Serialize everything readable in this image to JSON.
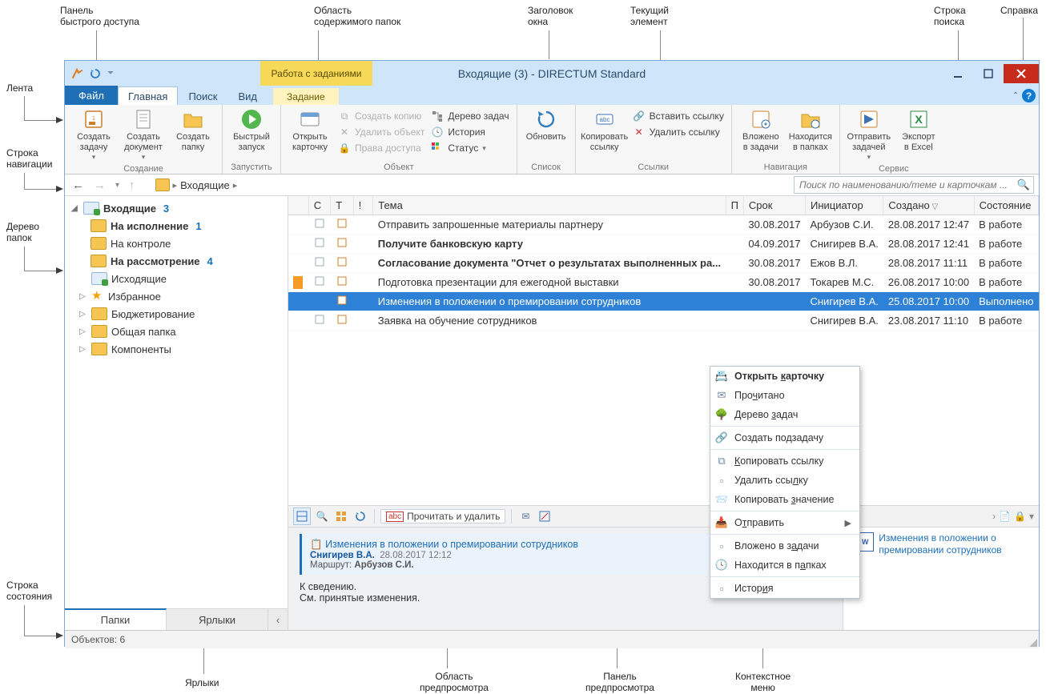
{
  "callouts": {
    "qat": "Панель\nбыстрого доступа",
    "folder_content": "Область\nсодержимого папок",
    "window_title": "Заголовок\nокна",
    "current_element": "Текущий\nэлемент",
    "search_bar": "Строка\nпоиска",
    "help": "Справка",
    "ribbon": "Лента",
    "nav_bar": "Строка\nнавигации",
    "folder_tree": "Дерево\nпапок",
    "status_bar": "Строка\nсостояния",
    "shortcuts": "Ярлыки",
    "preview_area": "Область\nпредпросмотра",
    "preview_panel": "Панель\nпредпросмотра",
    "context_menu": "Контекстное\nменю"
  },
  "titlebar": {
    "title": "Входящие (3) - DIRECTUM Standard"
  },
  "contextual_group": "Работа с заданиями",
  "tabs": {
    "file": "Файл",
    "home": "Главная",
    "search": "Поиск",
    "view": "Вид",
    "task": "Задание"
  },
  "ribbon": {
    "create": {
      "label": "Создание",
      "create_task": "Создать\nзадачу",
      "create_document": "Создать\nдокумент",
      "create_folder": "Создать\nпапку"
    },
    "run": {
      "label": "Запустить",
      "quick_start": "Быстрый\nзапуск"
    },
    "object": {
      "label": "Объект",
      "open_card": "Открыть\nкарточку",
      "create_copy": "Создать копию",
      "delete_object": "Удалить объект",
      "access_rights": "Права доступа",
      "task_tree": "Дерево задач",
      "history": "История",
      "status": "Статус"
    },
    "list": {
      "label": "Список",
      "refresh": "Обновить"
    },
    "links": {
      "label": "Ссылки",
      "copy_link": "Копировать\nссылку",
      "insert_link": "Вставить ссылку",
      "delete_link": "Удалить ссылку"
    },
    "navigation": {
      "label": "Навигация",
      "in_tasks": "Вложено\nв задачи",
      "in_folders": "Находится\nв папках"
    },
    "service": {
      "label": "Сервис",
      "send_tasks": "Отправить\nзадачей",
      "export_excel": "Экспорт\nв Excel"
    }
  },
  "nav": {
    "breadcrumb_root_icon": "folder",
    "breadcrumb": "Входящие",
    "search_placeholder": "Поиск по наименованию/теме и карточкам ..."
  },
  "tree": [
    {
      "name": "Входящие",
      "count": "3",
      "bold": true,
      "expanded": true,
      "icon": "blue",
      "children": [
        {
          "name": "На исполнение",
          "count": "1",
          "bold": true,
          "icon": "yellow"
        },
        {
          "name": "На контроле",
          "icon": "yellow"
        },
        {
          "name": "На рассмотрение",
          "count": "4",
          "bold": true,
          "icon": "yellow"
        }
      ]
    },
    {
      "name": "Исходящие",
      "icon": "blue"
    },
    {
      "name": "Избранное",
      "icon": "star",
      "expandable": true
    },
    {
      "name": "Бюджетирование",
      "icon": "yellow",
      "expandable": true
    },
    {
      "name": "Общая папка",
      "icon": "yellow",
      "expandable": true
    },
    {
      "name": "Компоненты",
      "icon": "yellow",
      "expandable": true
    }
  ],
  "footer_tabs": {
    "folders": "Папки",
    "shortcuts": "Ярлыки"
  },
  "grid": {
    "columns": {
      "c": "С",
      "t": "Т",
      "bang": "!",
      "theme": "Тема",
      "p": "П",
      "due": "Срок",
      "initiator": "Инициатор",
      "created": "Создано",
      "state": "Состояние"
    },
    "rows": [
      {
        "theme": "Отправить запрошенные материалы партнеру",
        "due": "30.08.2017",
        "initiator": "Арбузов С.И.",
        "created": "28.08.2017 12:47",
        "state": "В работе"
      },
      {
        "theme": "Получите банковскую карту",
        "bold": true,
        "due": "04.09.2017",
        "initiator": "Снигирев В.А.",
        "created": "28.08.2017 12:41",
        "state": "В работе"
      },
      {
        "theme": "Согласование документа \"Отчет о результатах выполненных ра...",
        "bold": true,
        "due": "30.08.2017",
        "initiator": "Ежов В.Л.",
        "created": "28.08.2017 11:11",
        "state": "В работе"
      },
      {
        "theme": "Подготовка презентации для ежегодной выставки",
        "mark": "orange",
        "due": "30.08.2017",
        "initiator": "Токарев М.С.",
        "created": "26.08.2017 10:00",
        "state": "В работе"
      },
      {
        "theme": "Изменения в положении о премировании сотрудников",
        "selected": true,
        "initiator": "Снигирев В.А.",
        "created": "25.08.2017 10:00",
        "state": "Выполнено"
      },
      {
        "theme": "Заявка на обучение сотрудников",
        "initiator": "Снигирев В.А.",
        "created": "23.08.2017 11:10",
        "state": "В работе"
      }
    ]
  },
  "preview_toolbar": {
    "read_delete": "Прочитать и удалить"
  },
  "preview": {
    "title": "Изменения в положении о премировании сотрудников",
    "author": "Снигирев В.А.",
    "datetime": "28.08.2017 12:12",
    "route_label": "Маршрут:",
    "route_value": "Арбузов С.И.",
    "body_line1": "К сведению.",
    "body_line2": "См. принятые изменения.",
    "attachment": "Изменения в положении о премировании сотрудников"
  },
  "context_menu": [
    {
      "label": "Открыть карточку",
      "bold": true,
      "u": 8,
      "sep_after": false
    },
    {
      "label": "Прочитано",
      "u": 3
    },
    {
      "label": "Дерево задач",
      "u": 7
    },
    "sep",
    {
      "label": "Создать подзадачу",
      "u": 10
    },
    "sep",
    {
      "label": "Копировать ссылку",
      "u": 0
    },
    {
      "label": "Удалить ссылку",
      "u": 11
    },
    {
      "label": "Копировать значение",
      "u": 11
    },
    "sep",
    {
      "label": "Отправить",
      "sub": true,
      "u": 1
    },
    "sep",
    {
      "label": "Вложено в задачи",
      "u": 11
    },
    {
      "label": "Находится в папках",
      "u": 13
    },
    "sep",
    {
      "label": "История",
      "u": 5
    }
  ],
  "statusbar": {
    "objects_label": "Объектов:",
    "objects_count": "6"
  }
}
